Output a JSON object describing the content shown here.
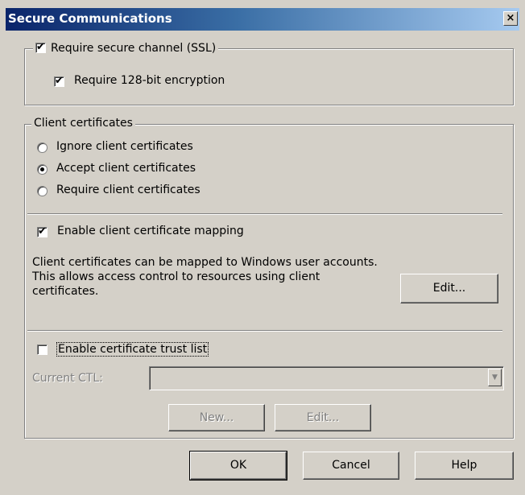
{
  "window": {
    "title": "Secure Communications",
    "close_glyph": "×"
  },
  "ssl_group": {
    "require_ssl": {
      "label": "Require secure channel (SSL)",
      "checked": true
    },
    "require_128": {
      "label": "Require 128-bit encryption",
      "checked": true
    }
  },
  "client_certs": {
    "legend": "Client certificates",
    "options": [
      {
        "label": "Ignore client certificates",
        "selected": false
      },
      {
        "label": "Accept client certificates",
        "selected": true
      },
      {
        "label": "Require client certificates",
        "selected": false
      }
    ],
    "mapping": {
      "label": "Enable client certificate mapping",
      "checked": true
    },
    "description": "Client certificates can be mapped to Windows user accounts.  This allows access control to resources using client certificates.",
    "edit_button": "Edit...",
    "ctl": {
      "label": "Enable certificate trust list",
      "checked": false
    },
    "current_ctl_label": "Current CTL:",
    "current_ctl_value": "",
    "new_button": "New...",
    "edit_ctl_button": "Edit..."
  },
  "footer": {
    "ok": "OK",
    "cancel": "Cancel",
    "help": "Help"
  },
  "icons": {
    "check": "✔",
    "dropdown": "▼"
  }
}
